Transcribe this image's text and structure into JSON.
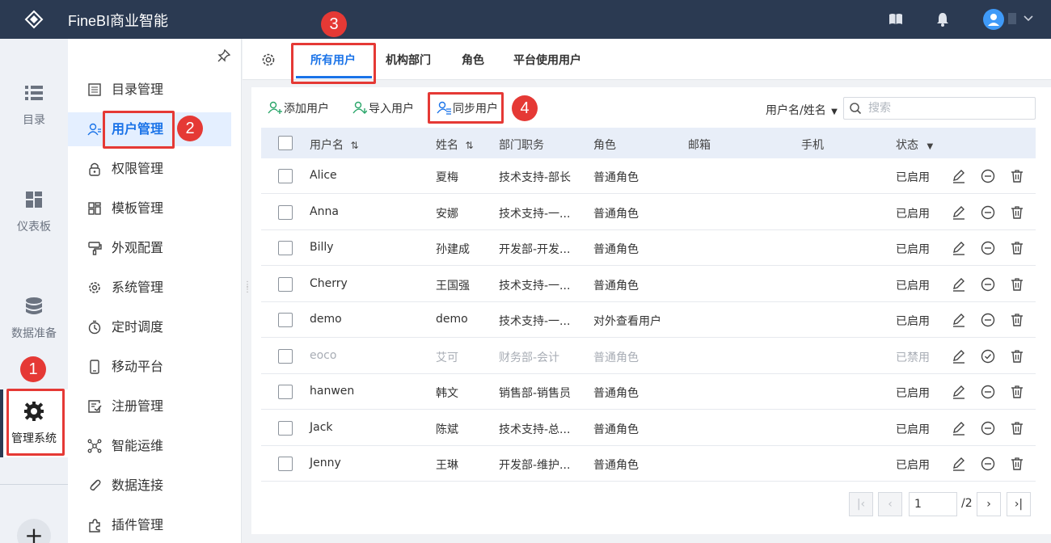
{
  "app": {
    "title": "FineBI商业智能"
  },
  "rail": {
    "items": [
      {
        "label": "目录",
        "icon": "list-icon"
      },
      {
        "label": "仪表板",
        "icon": "dashboard-icon"
      },
      {
        "label": "数据准备",
        "icon": "database-icon"
      },
      {
        "label": "管理系统",
        "icon": "gear-icon",
        "active": true
      }
    ],
    "add_label": "+"
  },
  "sidebar": {
    "items": [
      {
        "label": "目录管理",
        "icon": "catalog-icon"
      },
      {
        "label": "用户管理",
        "icon": "user-manage-icon",
        "active": true
      },
      {
        "label": "权限管理",
        "icon": "lock-icon"
      },
      {
        "label": "模板管理",
        "icon": "template-icon"
      },
      {
        "label": "外观配置",
        "icon": "paint-icon"
      },
      {
        "label": "系统管理",
        "icon": "settings-icon"
      },
      {
        "label": "定时调度",
        "icon": "timer-icon"
      },
      {
        "label": "移动平台",
        "icon": "mobile-icon"
      },
      {
        "label": "注册管理",
        "icon": "register-icon"
      },
      {
        "label": "智能运维",
        "icon": "ops-icon"
      },
      {
        "label": "数据连接",
        "icon": "link-icon"
      },
      {
        "label": "插件管理",
        "icon": "plugin-icon"
      }
    ]
  },
  "tabs": [
    {
      "label": "所有用户",
      "active": true
    },
    {
      "label": "机构部门"
    },
    {
      "label": "角色"
    },
    {
      "label": "平台使用用户"
    }
  ],
  "toolbar": {
    "add_user": "添加用户",
    "import_user": "导入用户",
    "sync_user": "同步用户",
    "filter_label": "用户名/姓名",
    "search_placeholder": "搜索"
  },
  "table": {
    "headers": {
      "username": "用户名",
      "name": "姓名",
      "dept": "部门职务",
      "role": "角色",
      "email": "邮箱",
      "phone": "手机",
      "status": "状态"
    },
    "rows": [
      {
        "username": "Alice",
        "name": "夏梅",
        "dept": "技术支持-部长",
        "role": "普通角色",
        "status": "已启用",
        "enabled": true
      },
      {
        "username": "Anna",
        "name": "安娜",
        "dept": "技术支持-一...",
        "role": "普通角色",
        "status": "已启用",
        "enabled": true
      },
      {
        "username": "Billy",
        "name": "孙建成",
        "dept": "开发部-开发...",
        "role": "普通角色",
        "status": "已启用",
        "enabled": true
      },
      {
        "username": "Cherry",
        "name": "王国强",
        "dept": "技术支持-一...",
        "role": "普通角色",
        "status": "已启用",
        "enabled": true
      },
      {
        "username": "demo",
        "name": "demo",
        "dept": "技术支持-一...",
        "role": "对外查看用户",
        "status": "已启用",
        "enabled": true
      },
      {
        "username": "eoco",
        "name": "艾可",
        "dept": "财务部-会计",
        "role": "普通角色",
        "status": "已禁用",
        "enabled": false
      },
      {
        "username": "hanwen",
        "name": "韩文",
        "dept": "销售部-销售员",
        "role": "普通角色",
        "status": "已启用",
        "enabled": true
      },
      {
        "username": "Jack",
        "name": "陈斌",
        "dept": "技术支持-总...",
        "role": "普通角色",
        "status": "已启用",
        "enabled": true
      },
      {
        "username": "Jenny",
        "name": "王琳",
        "dept": "开发部-维护...",
        "role": "普通角色",
        "status": "已启用",
        "enabled": true
      }
    ]
  },
  "pagination": {
    "current": "1",
    "total": "/2"
  },
  "annotations": [
    "1",
    "2",
    "3",
    "4"
  ],
  "colors": {
    "accent": "#1a73e8",
    "topbar": "#2b3a52",
    "highlight": "#e53935"
  }
}
